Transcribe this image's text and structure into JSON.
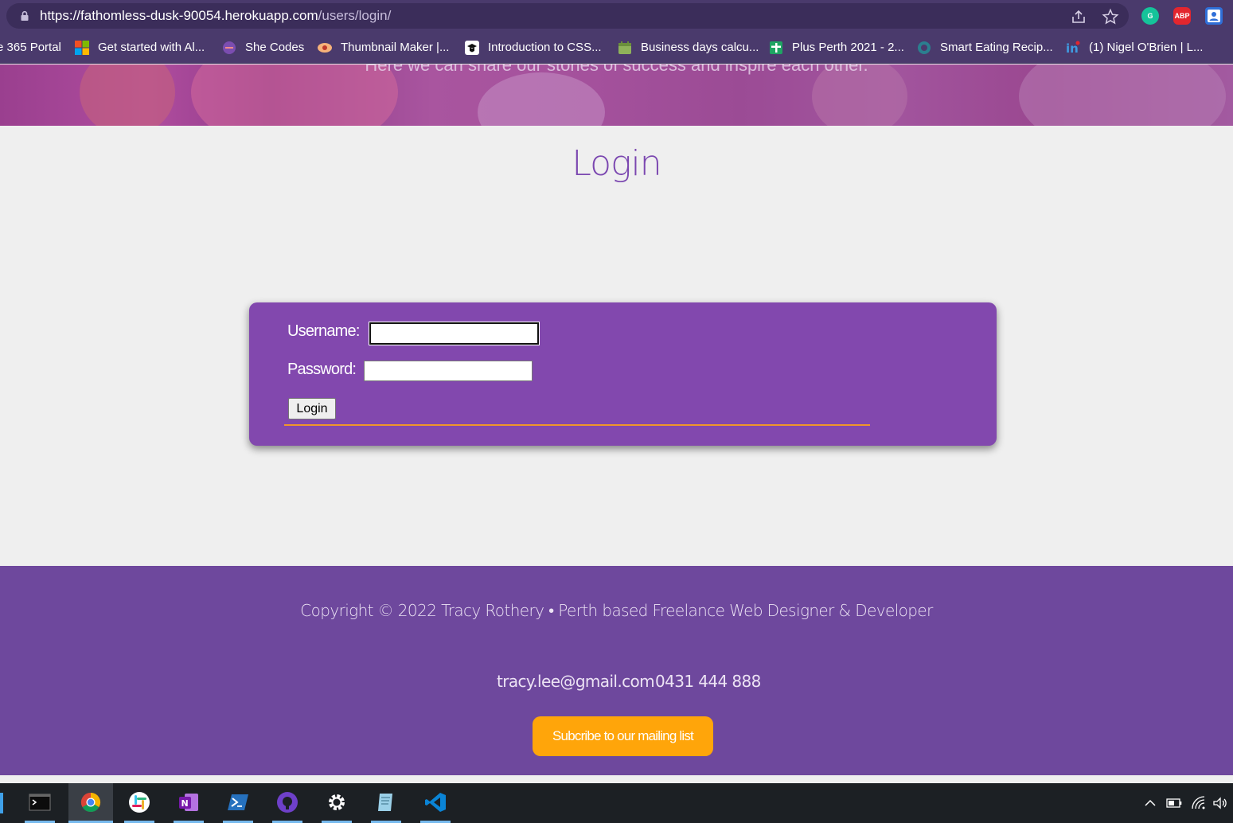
{
  "browser": {
    "url_host": "https://fathomless-dusk-90054.herokuapp.com",
    "url_path": "/users/login/",
    "extensions": [
      {
        "name": "grammarly-extension",
        "text": "G",
        "color": "#15c39a"
      },
      {
        "name": "adblock-plus-extension",
        "text": "ABP",
        "color": "#e3262e"
      },
      {
        "name": "profile-extension",
        "text": "",
        "color": "#2f6fd8"
      }
    ]
  },
  "bookmarks": [
    {
      "label": "e 365 Portal",
      "icon": "none"
    },
    {
      "label": "Get started with Al...",
      "icon": "microsoft-logo-icon"
    },
    {
      "label": "She Codes",
      "icon": "she-codes-icon"
    },
    {
      "label": "Thumbnail Maker |...",
      "icon": "thumbnail-maker-icon"
    },
    {
      "label": "Introduction to CSS...",
      "icon": "css-course-icon"
    },
    {
      "label": "Business days calcu...",
      "icon": "calendar-icon"
    },
    {
      "label": "Plus Perth 2021 - 2...",
      "icon": "google-sheets-icon"
    },
    {
      "label": "Smart Eating Recip...",
      "icon": "smart-eating-icon"
    },
    {
      "label": "(1) Nigel O'Brien | L...",
      "icon": "linkedin-icon"
    }
  ],
  "hero": {
    "tagline": "Here we can share our stories of success and inspire each other."
  },
  "main": {
    "title": "Login",
    "form": {
      "username_label": "Username:",
      "username_value": "",
      "password_label": "Password:",
      "password_value": "",
      "submit_label": "Login"
    }
  },
  "footer": {
    "copyright": "Copyright © 2022 Tracy Rothery • Perth based Freelance Web Designer & Developer",
    "email": "tracy.lee@gmail.com",
    "phone": "0431 444 888",
    "subscribe_label": "Subcribe to our mailing list"
  },
  "colors": {
    "brand_purple": "#8248ae",
    "footer_purple": "#6e489d",
    "title_purple": "#7b47b0",
    "accent_orange": "#ffa50a"
  },
  "taskbar": {
    "apps": [
      "terminal-icon",
      "chrome-icon",
      "slack-icon",
      "onenote-icon",
      "powershell-icon",
      "github-desktop-icon",
      "settings-icon",
      "notepad-icon",
      "vscode-icon"
    ],
    "active_app": "chrome-icon",
    "tray": [
      "chevron-up-icon",
      "battery-icon",
      "wifi-icon",
      "volume-icon"
    ]
  }
}
